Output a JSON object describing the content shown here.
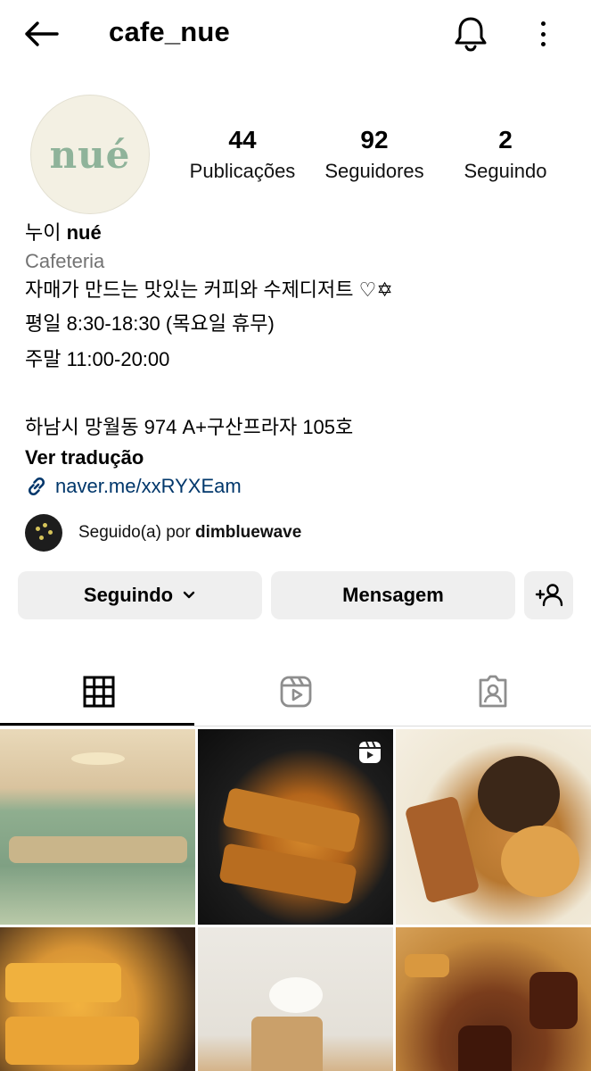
{
  "header": {
    "username": "cafe_nue",
    "back_icon": "arrow-left-icon",
    "bell_icon": "bell-icon",
    "more_icon": "more-vertical-icon"
  },
  "profile": {
    "avatar_logo_text": "nué",
    "stats": {
      "posts_count": "44",
      "posts_label": "Publicações",
      "followers_count": "92",
      "followers_label": "Seguidores",
      "following_count": "2",
      "following_label": "Seguindo"
    },
    "bio": {
      "name_kr": "누이",
      "name_bold": "nué",
      "category": "Cafeteria",
      "line1": "자매가 만드는 맛있는 커피와 수제디저트 ♡✡",
      "line2": "평일 8:30-18:30 (목요일 휴무)",
      "line3": "주말 11:00-20:00",
      "line4": "하남시 망월동 974 A+구산프라자 105호",
      "translate": "Ver tradução",
      "link": "naver.me/xxRYXEam"
    },
    "followed_by": {
      "prefix": "Seguido(a) por",
      "user": "dimbluewave"
    }
  },
  "actions": {
    "following_label": "Seguindo",
    "message_label": "Mensagem",
    "add_user_icon": "add-user-icon"
  },
  "tabs": [
    {
      "icon": "grid-icon",
      "active": true
    },
    {
      "icon": "reels-icon",
      "active": false
    },
    {
      "icon": "tagged-icon",
      "active": false
    }
  ],
  "colors": {
    "link": "#00376b",
    "button_bg": "#efefef",
    "category": "#737373",
    "avatar_logo": "#8fb39a"
  }
}
